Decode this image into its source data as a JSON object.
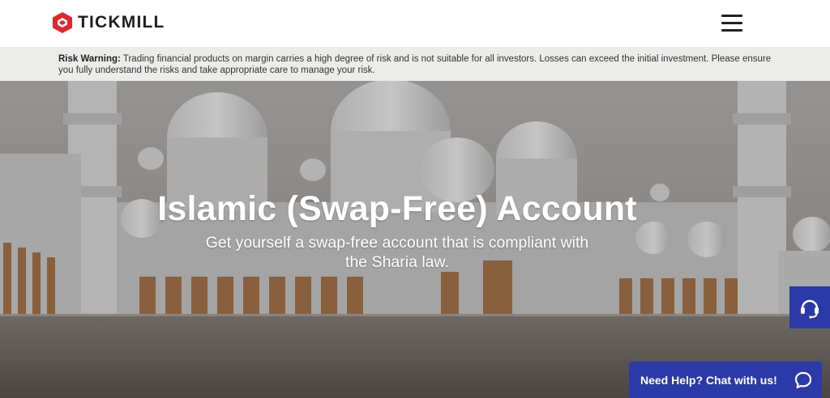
{
  "header": {
    "logo_text": "TICKMILL",
    "logo_icon": "tickmill-hexagon-logo",
    "menu_icon": "hamburger-menu-icon"
  },
  "risk_warning": {
    "label": "Risk Warning:",
    "text": " Trading financial products on margin carries a high degree of risk and is not suitable for all investors. Losses can exceed the initial investment. Please ensure you fully understand the risks and take appropriate care to manage your risk."
  },
  "hero": {
    "title": "Islamic (Swap-Free) Account",
    "subtitle": "Get yourself a swap-free account that is compliant with the Sharia law."
  },
  "support": {
    "support_icon": "headset-icon",
    "chat_label": "Need Help? Chat with us!",
    "chat_icon": "chat-bubble-icon"
  },
  "colors": {
    "brand_red": "#e3262e",
    "support_blue": "#2b3aa8",
    "risk_bg": "#ececea"
  }
}
